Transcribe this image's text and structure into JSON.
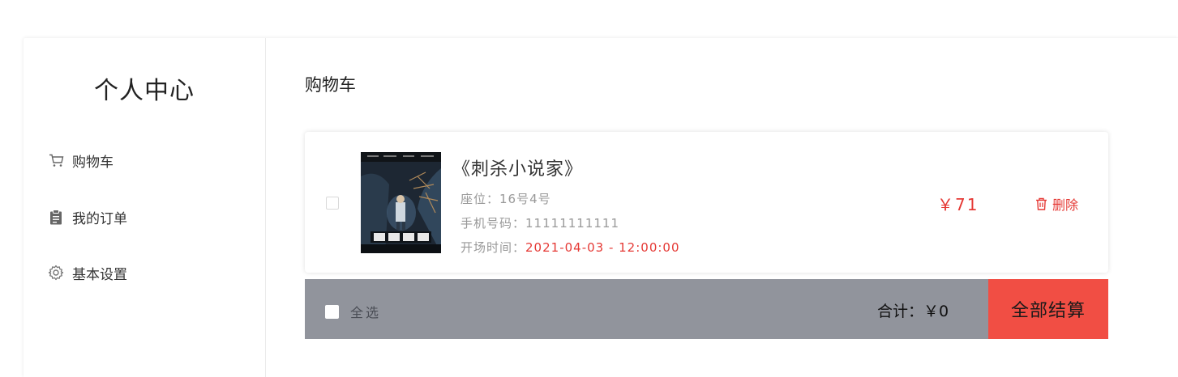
{
  "sidebar": {
    "title": "个人中心",
    "items": [
      {
        "icon": "cart-icon",
        "label": "购物车"
      },
      {
        "icon": "clipboard-icon",
        "label": "我的订单"
      },
      {
        "icon": "gear-icon",
        "label": "基本设置"
      }
    ]
  },
  "main": {
    "title": "购物车",
    "cart_items": [
      {
        "title": "《刺杀小说家》",
        "seat_label": "座位：",
        "seat": "16号4号",
        "phone_label": "手机号码：",
        "phone": "11111111111",
        "showtime_label": "开场时间：",
        "showtime": "2021-04-03 - 12:00:00",
        "price": "￥71",
        "delete_label": "删除",
        "checked": false
      }
    ],
    "footer": {
      "select_all_label": "全选",
      "total_label": "合计：",
      "total_value": "￥0",
      "checkout_label": "全部结算"
    }
  },
  "colors": {
    "accent_red": "#e53935",
    "checkout_bg": "#f14e44",
    "footer_bg": "#91949c"
  }
}
